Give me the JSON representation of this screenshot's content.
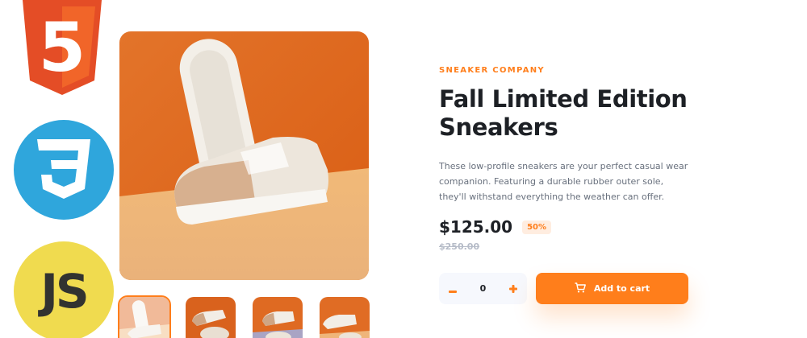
{
  "logos": {
    "html": "5",
    "css": "3",
    "js": "JS"
  },
  "product": {
    "company": "SNEAKER COMPANY",
    "title": "Fall Limited Edition Sneakers",
    "description": "These low-profile sneakers are your perfect casual wear companion. Featuring a durable rubber outer sole, they'll withstand everything the weather can offer.",
    "price": "$125.00",
    "discount": "50%",
    "original_price": "$250.00"
  },
  "cart": {
    "quantity": "0",
    "minus_icon": "minus-icon",
    "plus_icon": "plus-icon",
    "add_label": "Add to cart",
    "cart_icon": "cart-icon"
  },
  "colors": {
    "accent": "#ff7e1b",
    "accent_pale": "#ffede0",
    "dark": "#1d2025",
    "text_gray": "#68707d",
    "light_gray": "#b6bcc8",
    "html5_orange": "#e44d26",
    "css3_blue": "#2fa6dc",
    "js_yellow": "#f0db4f"
  }
}
